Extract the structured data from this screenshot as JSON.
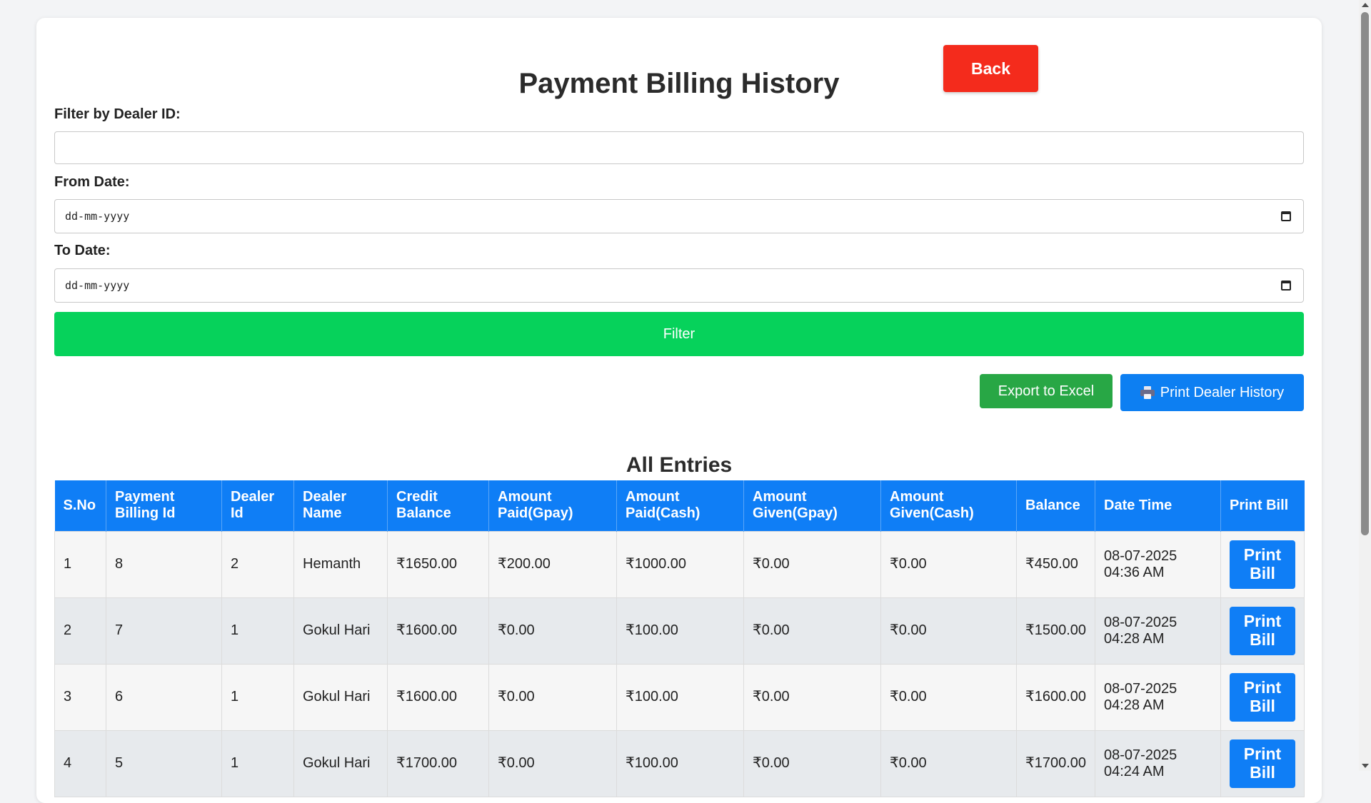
{
  "page": {
    "title": "Payment Billing History",
    "back_label": "Back"
  },
  "filters": {
    "dealer_label": "Filter by Dealer ID:",
    "dealer_value": "",
    "from_label": "From Date:",
    "from_placeholder": "dd-mm-yyyy",
    "to_label": "To Date:",
    "to_placeholder": "dd-mm-yyyy",
    "filter_label": "Filter"
  },
  "actions": {
    "export_label": "Export to Excel",
    "print_history_label": "Print Dealer History",
    "print_history_icon": "printer-icon"
  },
  "table": {
    "section_title": "All Entries",
    "headers": [
      "S.No",
      "Payment Billing Id",
      "Dealer Id",
      "Dealer Name",
      "Credit Balance",
      "Amount Paid(Gpay)",
      "Amount Paid(Cash)",
      "Amount Given(Gpay)",
      "Amount Given(Cash)",
      "Balance",
      "Date Time",
      "Print Bill"
    ],
    "print_bill_label": "Print Bill",
    "rows": [
      [
        "1",
        "8",
        "2",
        "Hemanth",
        "₹1650.00",
        "₹200.00",
        "₹1000.00",
        "₹0.00",
        "₹0.00",
        "₹450.00",
        "08-07-2025 04:36 AM"
      ],
      [
        "2",
        "7",
        "1",
        "Gokul Hari",
        "₹1600.00",
        "₹0.00",
        "₹100.00",
        "₹0.00",
        "₹0.00",
        "₹1500.00",
        "08-07-2025 04:28 AM"
      ],
      [
        "3",
        "6",
        "1",
        "Gokul Hari",
        "₹1600.00",
        "₹0.00",
        "₹100.00",
        "₹0.00",
        "₹0.00",
        "₹1600.00",
        "08-07-2025 04:28 AM"
      ],
      [
        "4",
        "5",
        "1",
        "Gokul Hari",
        "₹1700.00",
        "₹0.00",
        "₹100.00",
        "₹0.00",
        "₹0.00",
        "₹1700.00",
        "08-07-2025 04:24 AM"
      ]
    ]
  },
  "colors": {
    "back": "#f42b1c",
    "filter": "#06d25b",
    "export": "#28a745",
    "primary": "#0f7ef6"
  }
}
